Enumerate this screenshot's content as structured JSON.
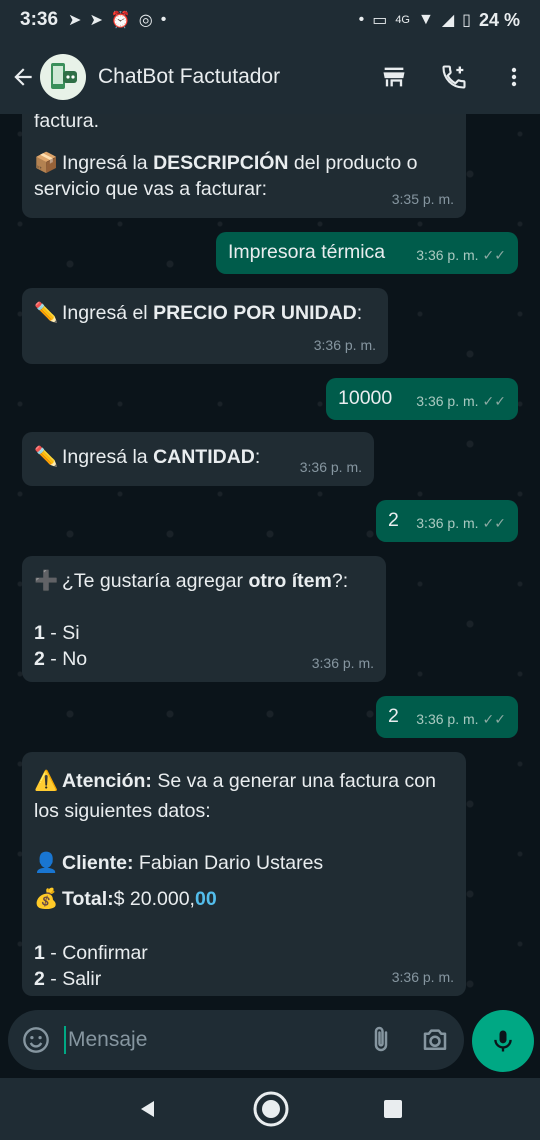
{
  "status_bar": {
    "time": "3:36",
    "network": "4G",
    "battery": "24 %"
  },
  "header": {
    "title": "ChatBot Factutador"
  },
  "messages": {
    "partial_top": "factura.",
    "m1": {
      "emoji": "📦",
      "pre": "Ingresá la ",
      "bold": "DESCRIPCIÓN",
      "post": " del producto o servicio que vas a facturar:",
      "time": "3:35 p. m."
    },
    "m2": {
      "text": "Impresora térmica",
      "time": "3:36 p. m."
    },
    "m3": {
      "emoji": "✏️",
      "pre": "Ingresá el ",
      "bold": "PRECIO POR UNIDAD",
      "post": ":",
      "time": "3:36 p. m."
    },
    "m4": {
      "text": "10000",
      "time": "3:36 p. m."
    },
    "m5": {
      "emoji": "✏️",
      "pre": "Ingresá la ",
      "bold": "CANTIDAD",
      "post": ":",
      "time": "3:36 p. m."
    },
    "m6": {
      "text": "2",
      "time": "3:36 p. m."
    },
    "m7": {
      "emoji": "➕",
      "pre": "¿Te gustaría agregar ",
      "bold": "otro ítem",
      "post": "?:",
      "opt1_num": "1",
      "opt1": " - Si",
      "opt2_num": "2",
      "opt2": " - No",
      "time": "3:36 p. m."
    },
    "m8": {
      "text": "2",
      "time": "3:36 p. m."
    },
    "m9": {
      "emoji": "⚠️",
      "bold": "Atención:",
      "post": " Se va a generar una factura con los siguientes datos:",
      "client_emoji": "👤",
      "client_label": "Cliente:",
      "client_value": " Fabian Dario Ustares",
      "total_emoji": "💰",
      "total_label": "Total:",
      "total_value": "$ 20.000,",
      "total_cents": "00",
      "opt1_num": "1",
      "opt1": " - Confirmar",
      "opt2_num": "2",
      "opt2": " - Salir",
      "time": "3:36 p. m."
    }
  },
  "input": {
    "placeholder": "Mensaje"
  },
  "colors": {
    "incoming": "#202c33",
    "outgoing": "#005c4b",
    "accent": "#00a884"
  },
  "icons": [
    "back-arrow-icon",
    "store-icon",
    "add-call-icon",
    "more-vert-icon",
    "emoji-icon",
    "attach-icon",
    "camera-icon",
    "mic-icon",
    "nav-back-icon",
    "nav-home-icon",
    "nav-recents-icon"
  ]
}
